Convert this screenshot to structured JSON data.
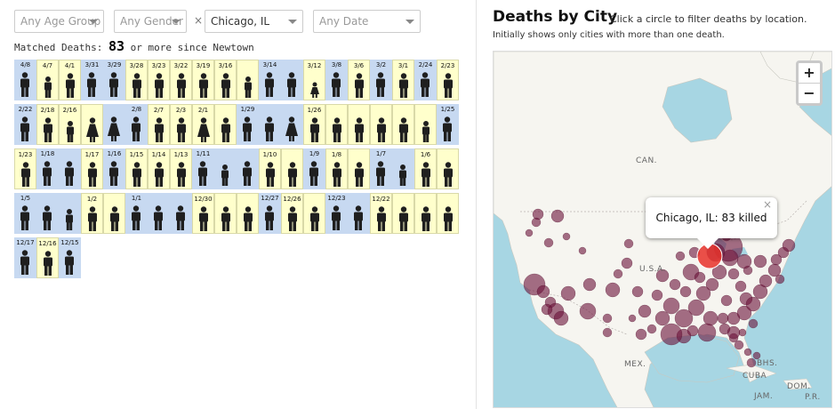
{
  "filters": {
    "age": "Any Age Group",
    "gender": "Any Gender",
    "city": "Chicago, IL",
    "city_clear": "×",
    "date": "Any Date"
  },
  "matched": {
    "prefix": "Matched Deaths:",
    "count": "83",
    "suffix": "or more since Newtown"
  },
  "rows": [
    [
      {
        "d": "4/8",
        "c": "blue",
        "i": "man"
      },
      {
        "d": "4/7",
        "c": "yellow",
        "i": "teen"
      },
      {
        "d": "4/1",
        "c": "yellow",
        "i": "man"
      },
      {
        "d": "3/31",
        "c": "blue",
        "i": "man"
      },
      {
        "d": "3/29",
        "c": "blue",
        "i": "man"
      },
      {
        "d": "3/28",
        "c": "yellow",
        "i": "man"
      },
      {
        "d": "3/23",
        "c": "yellow",
        "i": "man"
      },
      {
        "d": "3/22",
        "c": "yellow",
        "i": "man"
      },
      {
        "d": "3/19",
        "c": "yellow",
        "i": "man"
      },
      {
        "d": "3/16",
        "c": "yellow",
        "i": "man"
      },
      {
        "d": "",
        "c": "yellow",
        "i": "teen"
      },
      {
        "d": "3/14",
        "c": "blue",
        "i": "man"
      },
      {
        "d": "",
        "c": "blue",
        "i": "man"
      },
      {
        "d": "3/12",
        "c": "yellow",
        "i": "child"
      },
      {
        "d": "3/8",
        "c": "blue",
        "i": "man"
      },
      {
        "d": "3/6",
        "c": "yellow",
        "i": "man"
      },
      {
        "d": "3/2",
        "c": "blue",
        "i": "man"
      },
      {
        "d": "3/1",
        "c": "yellow",
        "i": "man"
      },
      {
        "d": "2/24",
        "c": "blue",
        "i": "man"
      },
      {
        "d": "2/23",
        "c": "yellow",
        "i": "man"
      }
    ],
    [
      {
        "d": "2/22",
        "c": "blue",
        "i": "man"
      },
      {
        "d": "2/18",
        "c": "yellow",
        "i": "man"
      },
      {
        "d": "2/16",
        "c": "yellow",
        "i": "teen"
      },
      {
        "d": "",
        "c": "yellow",
        "i": "woman"
      },
      {
        "d": "",
        "c": "blue",
        "i": "woman"
      },
      {
        "d": "2/8",
        "c": "blue",
        "i": "man"
      },
      {
        "d": "2/7",
        "c": "yellow",
        "i": "man"
      },
      {
        "d": "2/3",
        "c": "yellow",
        "i": "man"
      },
      {
        "d": "2/1",
        "c": "yellow",
        "i": "woman"
      },
      {
        "d": "",
        "c": "yellow",
        "i": "man"
      },
      {
        "d": "1/29",
        "c": "blue",
        "i": "man"
      },
      {
        "d": "",
        "c": "blue",
        "i": "man"
      },
      {
        "d": "",
        "c": "blue",
        "i": "woman"
      },
      {
        "d": "1/26",
        "c": "yellow",
        "i": "man"
      },
      {
        "d": "",
        "c": "yellow",
        "i": "man"
      },
      {
        "d": "",
        "c": "yellow",
        "i": "man"
      },
      {
        "d": "",
        "c": "yellow",
        "i": "man"
      },
      {
        "d": "",
        "c": "yellow",
        "i": "man"
      },
      {
        "d": "",
        "c": "yellow",
        "i": "teen"
      },
      {
        "d": "1/25",
        "c": "blue",
        "i": "man"
      }
    ],
    [
      {
        "d": "1/23",
        "c": "yellow",
        "i": "man"
      },
      {
        "d": "1/18",
        "c": "blue",
        "i": "man"
      },
      {
        "d": "",
        "c": "blue",
        "i": "man"
      },
      {
        "d": "1/17",
        "c": "yellow",
        "i": "man"
      },
      {
        "d": "1/16",
        "c": "blue",
        "i": "man"
      },
      {
        "d": "1/15",
        "c": "yellow",
        "i": "man"
      },
      {
        "d": "1/14",
        "c": "yellow",
        "i": "man"
      },
      {
        "d": "1/13",
        "c": "yellow",
        "i": "man"
      },
      {
        "d": "1/11",
        "c": "blue",
        "i": "man"
      },
      {
        "d": "",
        "c": "blue",
        "i": "teen"
      },
      {
        "d": "",
        "c": "blue",
        "i": "man"
      },
      {
        "d": "1/10",
        "c": "yellow",
        "i": "man"
      },
      {
        "d": "",
        "c": "yellow",
        "i": "man"
      },
      {
        "d": "1/9",
        "c": "blue",
        "i": "man"
      },
      {
        "d": "1/8",
        "c": "yellow",
        "i": "man"
      },
      {
        "d": "",
        "c": "yellow",
        "i": "man"
      },
      {
        "d": "1/7",
        "c": "blue",
        "i": "man"
      },
      {
        "d": "",
        "c": "blue",
        "i": "teen"
      },
      {
        "d": "1/6",
        "c": "yellow",
        "i": "man"
      },
      {
        "d": "",
        "c": "yellow",
        "i": "man"
      }
    ],
    [
      {
        "d": "1/5",
        "c": "blue",
        "i": "man"
      },
      {
        "d": "",
        "c": "blue",
        "i": "man"
      },
      {
        "d": "",
        "c": "blue",
        "i": "teen"
      },
      {
        "d": "1/2",
        "c": "yellow",
        "i": "man"
      },
      {
        "d": "",
        "c": "yellow",
        "i": "man"
      },
      {
        "d": "1/1",
        "c": "blue",
        "i": "man"
      },
      {
        "d": "",
        "c": "blue",
        "i": "man"
      },
      {
        "d": "",
        "c": "blue",
        "i": "man"
      },
      {
        "d": "12/30",
        "c": "yellow",
        "i": "man"
      },
      {
        "d": "",
        "c": "yellow",
        "i": "man"
      },
      {
        "d": "",
        "c": "yellow",
        "i": "man"
      },
      {
        "d": "12/27",
        "c": "blue",
        "i": "man"
      },
      {
        "d": "12/26",
        "c": "yellow",
        "i": "man"
      },
      {
        "d": "",
        "c": "yellow",
        "i": "man"
      },
      {
        "d": "12/23",
        "c": "blue",
        "i": "man"
      },
      {
        "d": "",
        "c": "blue",
        "i": "man"
      },
      {
        "d": "12/22",
        "c": "yellow",
        "i": "man"
      },
      {
        "d": "",
        "c": "yellow",
        "i": "man"
      },
      {
        "d": "",
        "c": "yellow",
        "i": "man"
      },
      {
        "d": "",
        "c": "yellow",
        "i": "man"
      }
    ],
    [
      {
        "d": "12/17",
        "c": "blue",
        "i": "man"
      },
      {
        "d": "12/16",
        "c": "yellow",
        "i": "man"
      },
      {
        "d": "12/15",
        "c": "blue",
        "i": "man"
      }
    ]
  ],
  "right": {
    "title": "Deaths by City",
    "hint": "Click a circle to filter deaths by location.",
    "sub": "Initially shows only cities with more than one death."
  },
  "map": {
    "zoom_in": "+",
    "zoom_out": "−",
    "popup": "Chicago, IL: 83 killed",
    "popup_close": "×",
    "labels": {
      "can": "CAN.",
      "usa": "U.S.A.",
      "mex": "MEX.",
      "cuba": "CUBA",
      "bhs": "BHS.",
      "jam": "JAM.",
      "dom": "DOM.",
      "pr": "P.R."
    },
    "colors": {
      "water": "#a7d6e3",
      "land": "#f6f5f0",
      "dot": "#6b1038",
      "selected": "#e8312a"
    }
  }
}
